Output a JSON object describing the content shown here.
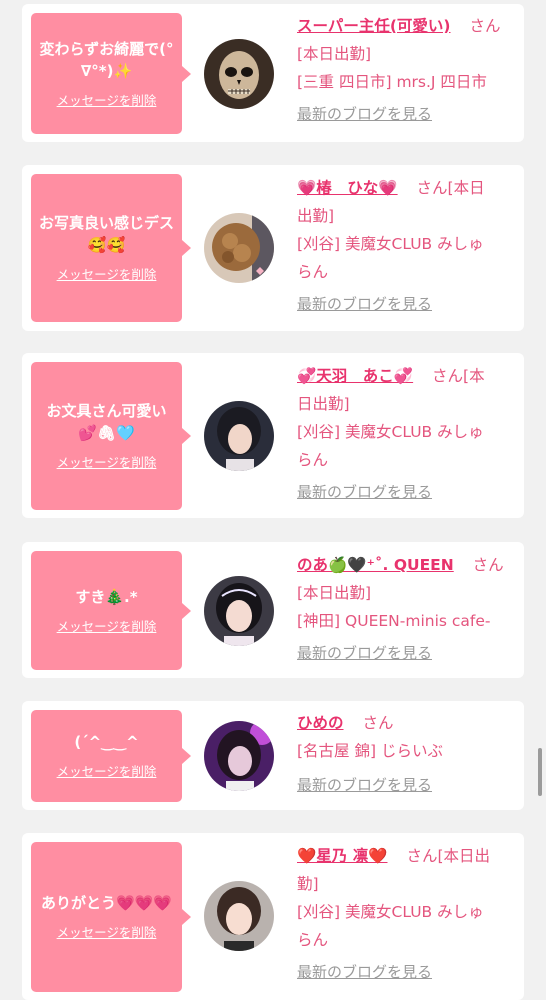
{
  "cards": [
    {
      "message": "変わらずお綺麗で(°∇°*)✨",
      "delete_label": "メッセージを削除",
      "name": "スーパー主任(可愛い)",
      "suffix": "さん",
      "detail_lines": [
        "[本日出勤]",
        "[三重 四日市] mrs.J 四日市"
      ],
      "blog_label": "最新のブログを見る"
    },
    {
      "message": "お写真良い感じデス🥰🥰",
      "delete_label": "メッセージを削除",
      "name": "💗椿　ひな💗",
      "suffix": "さん[本日",
      "detail_lines": [
        "出勤]",
        "[刈谷] 美魔女CLUB みしゅ",
        "らん"
      ],
      "blog_label": "最新のブログを見る"
    },
    {
      "message": "お文具さん可愛い💕🖇🩵",
      "delete_label": "メッセージを削除",
      "name": "💞天羽　あこ💞",
      "suffix": "さん[本",
      "detail_lines": [
        "日出勤]",
        "[刈谷] 美魔女CLUB みしゅ",
        "らん"
      ],
      "blog_label": "最新のブログを見る"
    },
    {
      "message": "すき🎄.*",
      "delete_label": "メッセージを削除",
      "name": "のあ🍏🖤⁺˚. QUEEN",
      "suffix": "さん",
      "detail_lines": [
        "[本日出勤]",
        "[神田] QUEEN-minis cafe-"
      ],
      "blog_label": "最新のブログを見る"
    },
    {
      "message": "(ˊ^‿‿^",
      "delete_label": "メッセージを削除",
      "name": "ひめの",
      "suffix": "さん",
      "detail_lines": [
        "[名古屋 錦] じらいぶ"
      ],
      "blog_label": "最新のブログを見る"
    },
    {
      "message": "ありがとう💗💗💗",
      "delete_label": "メッセージを削除",
      "name": "❤️星乃 凛❤️",
      "suffix": "さん[本日出",
      "detail_lines": [
        "勤]",
        "[刈谷] 美魔女CLUB みしゅ",
        "らん"
      ],
      "blog_label": "最新のブログを見る"
    }
  ],
  "colors": {
    "bubble": "#ff8ea2",
    "name": "#e8336d",
    "detail": "#e4557e",
    "blog_link": "#9a9a9a",
    "background": "#f1f1f1"
  },
  "icons": {
    "avatars": [
      "skull-mask-avatar",
      "hair-bun-avatar",
      "girl-portrait-avatar",
      "girl-portrait-avatar",
      "purple-light-avatar",
      "girl-portrait-avatar"
    ]
  }
}
